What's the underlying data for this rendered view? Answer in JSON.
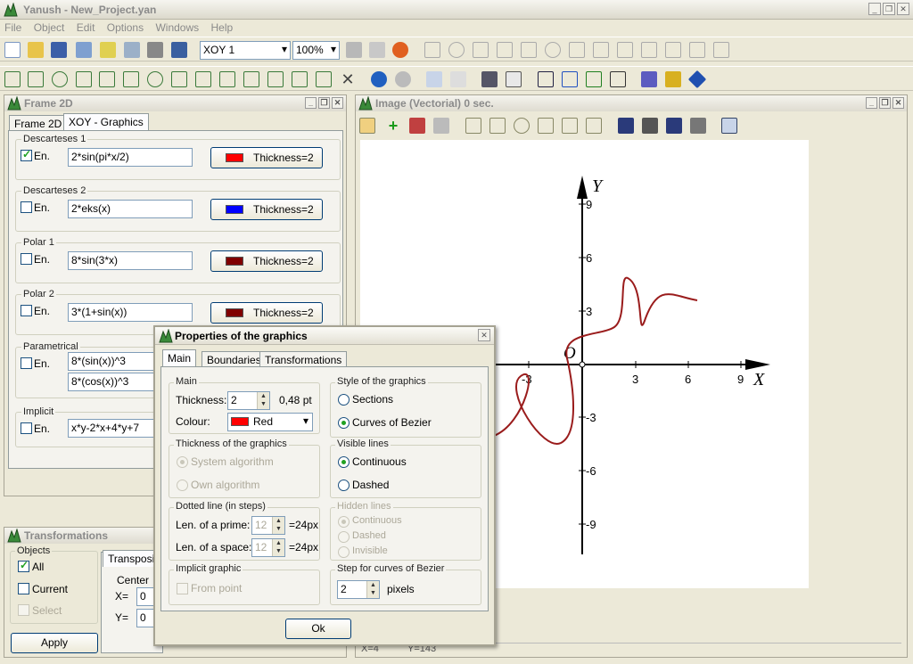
{
  "app": {
    "title": "Yanush  -  New_Project.yan"
  },
  "menu": [
    "File",
    "Object",
    "Edit",
    "Options",
    "Windows",
    "Help"
  ],
  "toolbar": {
    "view_select": "XOY 1",
    "zoom_select": "100%"
  },
  "frame2d": {
    "title": "Frame 2D",
    "tabs": [
      "Frame 2D",
      "XOY - Graphics"
    ],
    "enable_label": "En.",
    "groups": [
      {
        "title": "Descarteses 1",
        "checked": true,
        "formula": "2*sin(pi*x/2)",
        "color": "#ff0000",
        "button": "Thickness=2"
      },
      {
        "title": "Descarteses 2",
        "checked": false,
        "formula": "2*eks(x)",
        "color": "#0000ff",
        "button": "Thickness=2"
      },
      {
        "title": "Polar 1",
        "checked": false,
        "formula": "8*sin(3*x)",
        "color": "#800000",
        "button": "Thickness=2"
      },
      {
        "title": "Polar 2",
        "checked": false,
        "formula": "3*(1+sin(x))",
        "color": "#800000",
        "button": "Thickness=2"
      }
    ],
    "parametrical": {
      "title": "Parametrical",
      "f1": "8*(sin(x))^3",
      "f2": "8*(cos(x))^3"
    },
    "implicit": {
      "title": "Implicit",
      "formula": "x*y-2*x+4*y+7"
    }
  },
  "transformations": {
    "title": "Transformations",
    "objects_label": "Objects",
    "all": "All",
    "current": "Current",
    "select": "Select",
    "apply": "Apply",
    "tab": "Transpositi",
    "center": "Center",
    "x_label": "X=",
    "y_label": "Y=",
    "x_val": "0",
    "y_val": "0"
  },
  "image": {
    "title": "Image (Vectorial)  0 sec.",
    "axis_x": "X",
    "axis_y": "Y",
    "origin": "O",
    "x_ticks": [
      "-3",
      "3",
      "6",
      "9"
    ],
    "y_ticks": [
      "9",
      "6",
      "3",
      "-3",
      "-6",
      "-9"
    ],
    "status_x": "X=4",
    "status_y": "Y=143"
  },
  "dialog": {
    "title": "Properties of the graphics",
    "tabs": [
      "Main",
      "Boundaries",
      "Transformations"
    ],
    "main_group": "Main",
    "thickness_label": "Thickness:",
    "thickness_value": "2",
    "thickness_pt": "0,48 pt",
    "colour_label": "Colour:",
    "colour_value": "Red",
    "thick_group": "Thickness of the graphics",
    "system_algo": "System algorithm",
    "own_algo": "Own algorithm",
    "dotted_group": "Dotted line (in steps)",
    "len_prime": "Len. of a prime:",
    "len_space": "Len. of a space:",
    "prime_val": "12",
    "space_val": "12",
    "px_prime": "=24px",
    "px_space": "=24px",
    "implicit_group": "Implicit graphic",
    "from_point": "From point",
    "style_group": "Style of the graphics",
    "sections": "Sections",
    "bezier": "Curves of Bezier",
    "visible_group": "Visible lines",
    "continuous": "Continuous",
    "dashed": "Dashed",
    "hidden_group": "Hidden lines",
    "h_continuous": "Continuous",
    "h_dashed": "Dashed",
    "h_invisible": "Invisible",
    "step_group": "Step for curves of Bezier",
    "step_val": "2",
    "pixels": "pixels",
    "ok": "Ok"
  }
}
